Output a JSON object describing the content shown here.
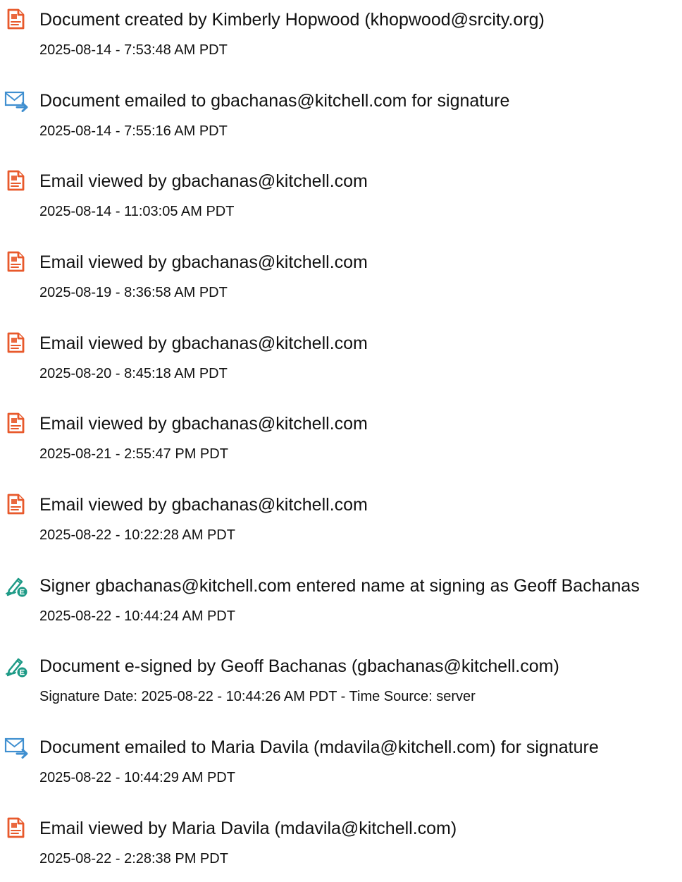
{
  "icons": {
    "document": "document-orange-icon",
    "email": "email-send-icon",
    "signature": "esign-pen-icon"
  },
  "colors": {
    "document_icon": "#e8592b",
    "email_icon": "#3f8fd0",
    "signature_icon": "#1d9a86",
    "text": "#111111"
  },
  "events": [
    {
      "icon": "document",
      "title": "Document created by Kimberly Hopwood (khopwood@srcity.org)",
      "meta": "2025-08-14 - 7:53:48 AM PDT"
    },
    {
      "icon": "email",
      "title": "Document emailed to gbachanas@kitchell.com for signature",
      "meta": "2025-08-14 - 7:55:16 AM PDT"
    },
    {
      "icon": "document",
      "title": "Email viewed by gbachanas@kitchell.com",
      "meta": "2025-08-14 - 11:03:05 AM PDT"
    },
    {
      "icon": "document",
      "title": "Email viewed by gbachanas@kitchell.com",
      "meta": "2025-08-19 - 8:36:58 AM PDT"
    },
    {
      "icon": "document",
      "title": "Email viewed by gbachanas@kitchell.com",
      "meta": "2025-08-20 - 8:45:18 AM PDT"
    },
    {
      "icon": "document",
      "title": "Email viewed by gbachanas@kitchell.com",
      "meta": "2025-08-21 - 2:55:47 PM PDT"
    },
    {
      "icon": "document",
      "title": "Email viewed by gbachanas@kitchell.com",
      "meta": "2025-08-22 - 10:22:28 AM PDT"
    },
    {
      "icon": "signature",
      "title": "Signer gbachanas@kitchell.com entered name at signing as Geoff Bachanas",
      "meta": "2025-08-22 - 10:44:24 AM PDT"
    },
    {
      "icon": "signature",
      "title": "Document e-signed by Geoff Bachanas (gbachanas@kitchell.com)",
      "meta": "Signature Date: 2025-08-22 - 10:44:26 AM PDT - Time Source: server"
    },
    {
      "icon": "email",
      "title": "Document emailed to Maria Davila (mdavila@kitchell.com) for signature",
      "meta": "2025-08-22 - 10:44:29 AM PDT"
    },
    {
      "icon": "document",
      "title": "Email viewed by Maria Davila (mdavila@kitchell.com)",
      "meta": "2025-08-22 - 2:28:38 PM PDT"
    }
  ]
}
